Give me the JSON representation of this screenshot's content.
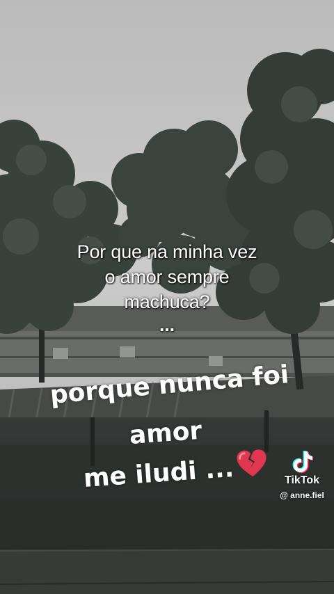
{
  "caption_top": {
    "lines": [
      "Por que na minha vez",
      "o amor sempre",
      "machuca?"
    ],
    "dots": "..."
  },
  "handwritten": {
    "line1": "porque nunca foi",
    "line2": "amor",
    "line3": "me iludi ...",
    "emoji": "broken-heart-icon"
  },
  "watermark": {
    "brand": "TikTok",
    "handle": "@ anne.fiel"
  },
  "colors": {
    "sky": "#cfcfcf",
    "foliage": "#3b433d",
    "text": "#ffffff",
    "heart": "#e0364f"
  }
}
